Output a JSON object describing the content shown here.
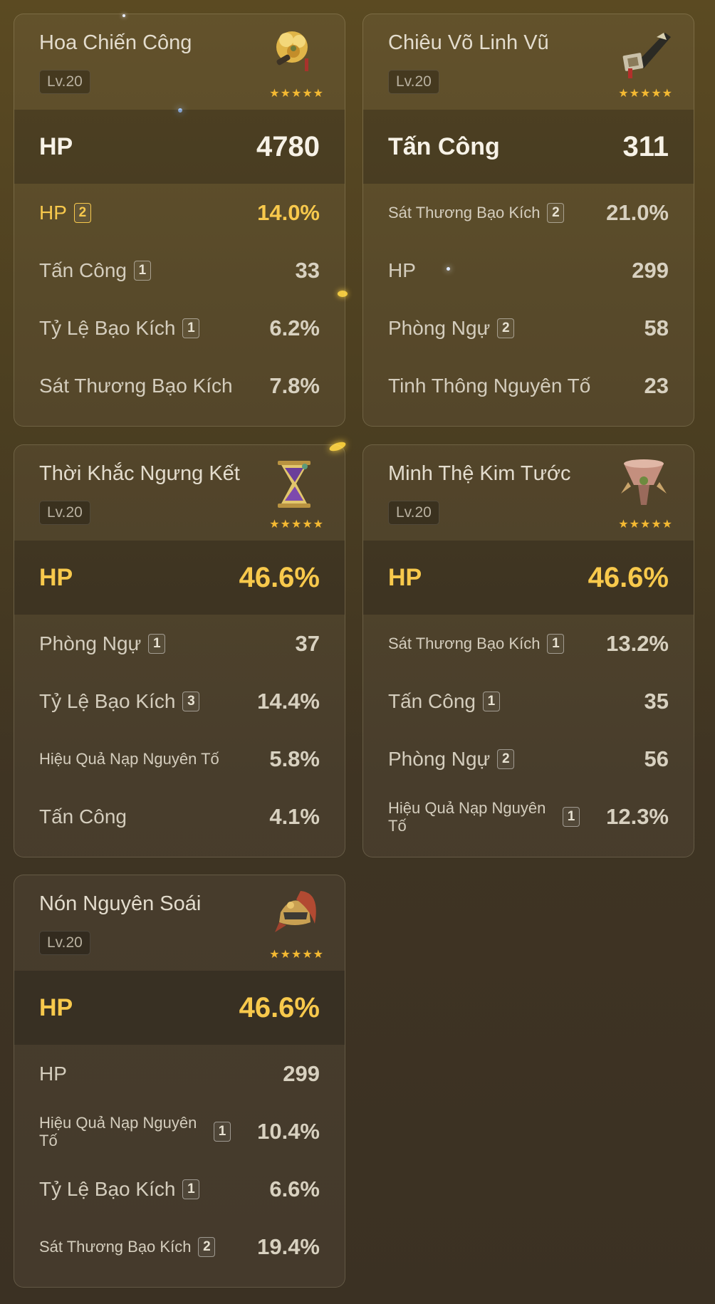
{
  "cards": [
    {
      "name": "Hoa Chiến Công",
      "level": "Lv.20",
      "icon": "flower-artifact-icon",
      "stars": 5,
      "main": {
        "label": "HP",
        "value": "4780",
        "color": "#f7f2e7"
      },
      "subs": [
        {
          "label": "HP",
          "rolls": "2",
          "value": "14.0%",
          "highlight": true
        },
        {
          "label": "Tấn Công",
          "rolls": "1",
          "value": "33"
        },
        {
          "label": "Tỷ Lệ Bạo Kích",
          "rolls": "1",
          "value": "6.2%"
        },
        {
          "label": "Sát Thương Bạo Kích",
          "rolls": "",
          "value": "7.8%"
        }
      ]
    },
    {
      "name": "Chiêu Võ Linh Vũ",
      "level": "Lv.20",
      "icon": "feather-artifact-icon",
      "stars": 5,
      "main": {
        "label": "Tấn Công",
        "value": "311",
        "color": "#f7f2e7"
      },
      "subs": [
        {
          "label": "Sát Thương Bạo Kích",
          "rolls": "2",
          "value": "21.0%",
          "small": true
        },
        {
          "label": "HP",
          "rolls": "",
          "value": "299"
        },
        {
          "label": "Phòng Ngự",
          "rolls": "2",
          "value": "58"
        },
        {
          "label": "Tinh Thông Nguyên Tố",
          "rolls": "",
          "value": "23"
        }
      ]
    },
    {
      "name": "Thời Khắc Ngưng Kết",
      "level": "Lv.20",
      "icon": "hourglass-artifact-icon",
      "stars": 5,
      "main": {
        "label": "HP",
        "value": "46.6%",
        "color": "#f8c94c"
      },
      "subs": [
        {
          "label": "Phòng Ngự",
          "rolls": "1",
          "value": "37"
        },
        {
          "label": "Tỷ Lệ Bạo Kích",
          "rolls": "3",
          "value": "14.4%"
        },
        {
          "label": "Hiệu Quả Nạp Nguyên Tố",
          "rolls": "",
          "value": "5.8%",
          "small": true
        },
        {
          "label": "Tấn Công",
          "rolls": "",
          "value": "4.1%"
        }
      ]
    },
    {
      "name": "Minh Thệ Kim Tước",
      "level": "Lv.20",
      "icon": "goblet-artifact-icon",
      "stars": 5,
      "main": {
        "label": "HP",
        "value": "46.6%",
        "color": "#f8c94c"
      },
      "subs": [
        {
          "label": "Sát Thương Bạo Kích",
          "rolls": "1",
          "value": "13.2%",
          "small": true
        },
        {
          "label": "Tấn Công",
          "rolls": "1",
          "value": "35"
        },
        {
          "label": "Phòng Ngự",
          "rolls": "2",
          "value": "56"
        },
        {
          "label": "Hiệu Quả Nạp Nguyên Tố",
          "rolls": "1",
          "value": "12.3%",
          "small": true
        }
      ]
    },
    {
      "name": "Nón Nguyên Soái",
      "level": "Lv.20",
      "icon": "helmet-artifact-icon",
      "stars": 5,
      "main": {
        "label": "HP",
        "value": "46.6%",
        "color": "#f8c94c"
      },
      "subs": [
        {
          "label": "HP",
          "rolls": "",
          "value": "299"
        },
        {
          "label": "Hiệu Quả Nạp Nguyên Tố",
          "rolls": "1",
          "value": "10.4%",
          "small": true
        },
        {
          "label": "Tỷ Lệ Bạo Kích",
          "rolls": "1",
          "value": "6.6%"
        },
        {
          "label": "Sát Thương Bạo Kích",
          "rolls": "2",
          "value": "19.4%",
          "small": true
        }
      ]
    }
  ]
}
